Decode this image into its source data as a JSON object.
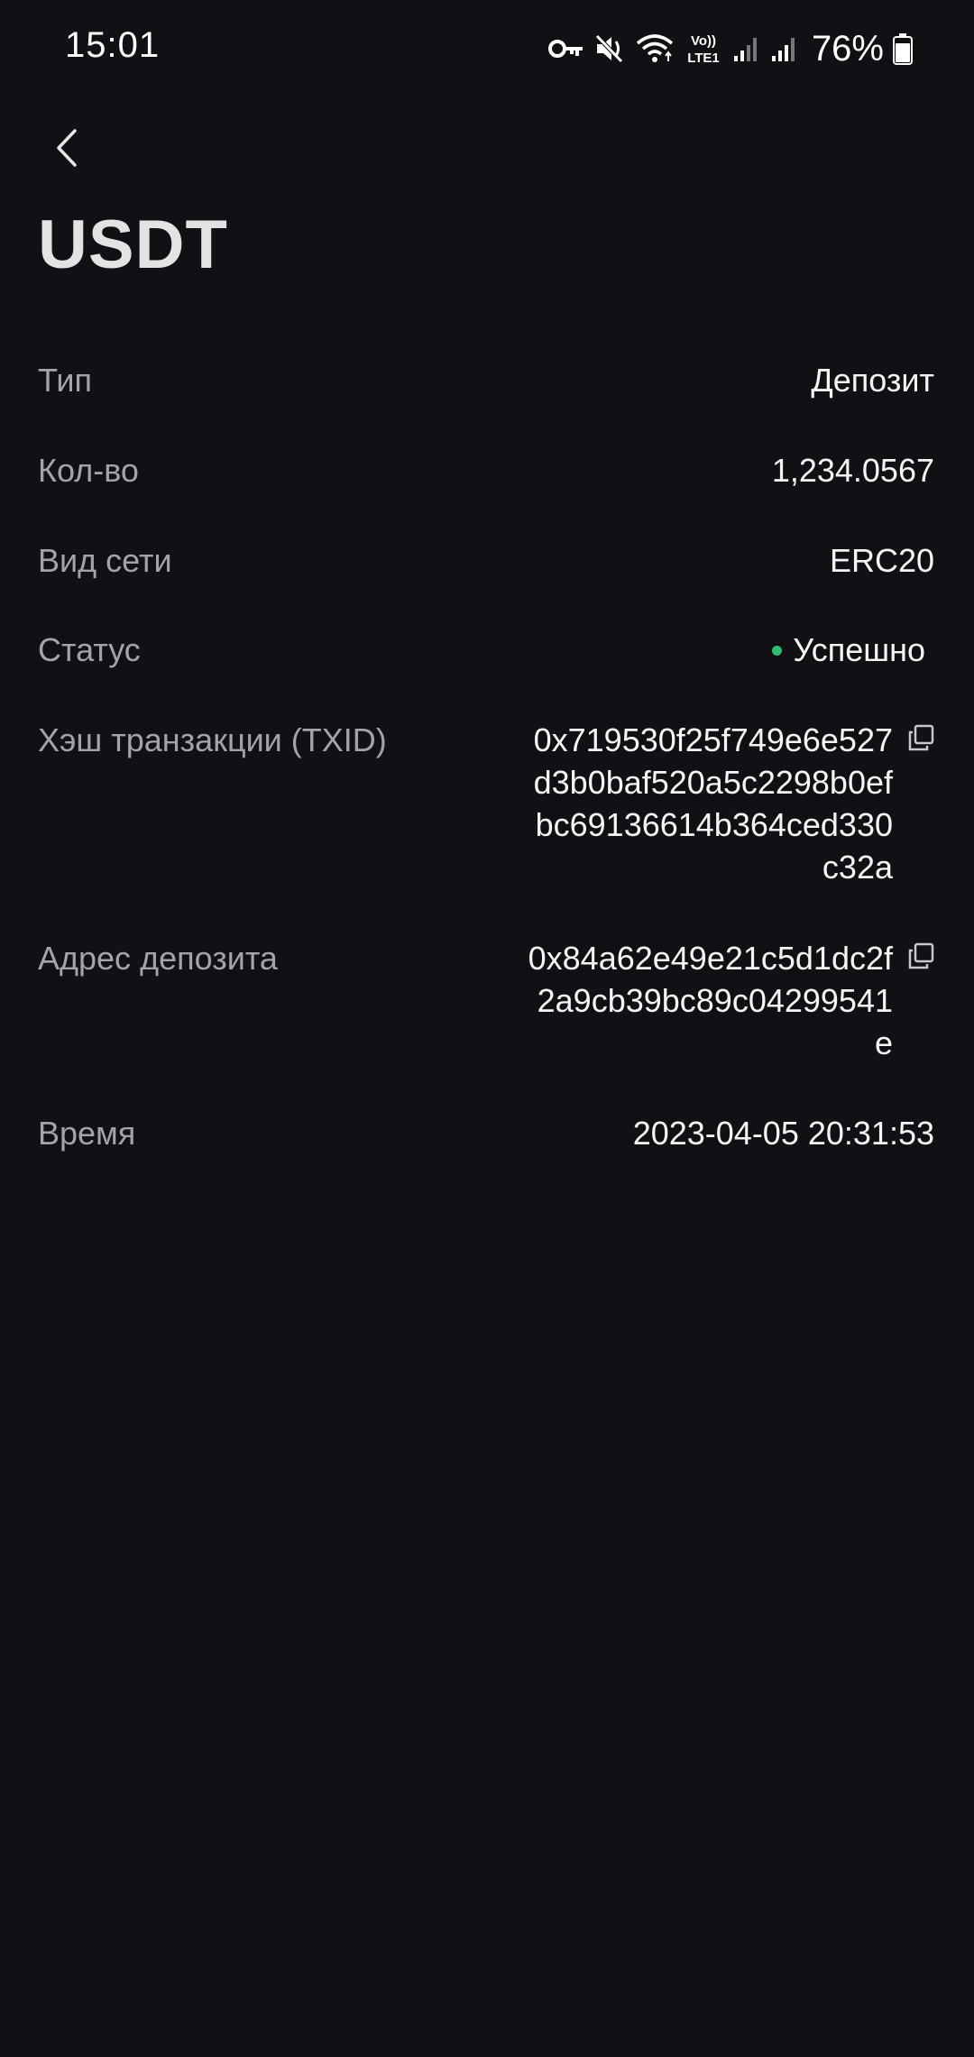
{
  "status_bar": {
    "time": "15:01",
    "battery": "76%",
    "icons": [
      "vpn-key-icon",
      "mute-icon",
      "wifi-icon",
      "volte-lte-icon",
      "signal-icon",
      "signal-icon",
      "battery-icon"
    ],
    "lte_label": "Vo)) LTE1"
  },
  "header": {
    "back_icon": "chevron-left-icon",
    "title": "USDT"
  },
  "details": {
    "type": {
      "label": "Тип",
      "value": "Депозит"
    },
    "amount": {
      "label": "Кол-во",
      "value": "1,234.0567"
    },
    "network": {
      "label": "Вид сети",
      "value": "ERC20"
    },
    "status": {
      "label": "Статус",
      "value": "Успешно",
      "color": "#2ebd6b"
    },
    "txid": {
      "label": "Хэш транзакции (TXID)",
      "value": "0x719530f25f749e6e527d3b0baf520a5c2298b0efbc69136614b364ced330c32a",
      "copy_icon": "copy-icon"
    },
    "deposit_address": {
      "label": "Адрес депозита",
      "value": "0x84a62e49e21c5d1dc2f2a9cb39bc89c04299541e",
      "copy_icon": "copy-icon"
    },
    "time": {
      "label": "Время",
      "value": "2023-04-05 20:31:53"
    }
  },
  "colors": {
    "background": "#111115",
    "label": "#a3a3a8",
    "value": "#f5f5f5",
    "success": "#2ebd6b"
  }
}
